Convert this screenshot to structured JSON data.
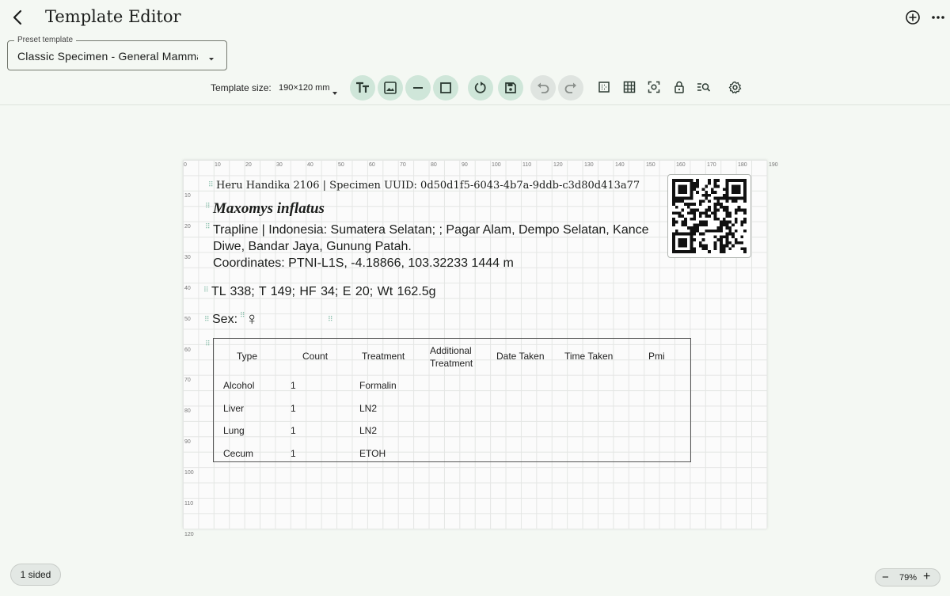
{
  "header": {
    "title": "Template Editor"
  },
  "preset": {
    "label": "Preset template",
    "value": "Classic Specimen - General Mammal"
  },
  "toolbar": {
    "size_label": "Template size:",
    "size_value": "190×120 mm",
    "buttons": [
      "text-icon",
      "image-icon",
      "line-icon",
      "rectangle-icon",
      "rotate-icon",
      "save-icon",
      "undo-icon",
      "redo-icon",
      "margin-icon",
      "grid-icon",
      "focus-icon",
      "lock-icon",
      "zoom-search-icon",
      "settings-icon"
    ]
  },
  "ruler": {
    "x": [
      "0",
      "10",
      "20",
      "30",
      "40",
      "50",
      "60",
      "70",
      "80",
      "90",
      "100",
      "110",
      "120",
      "130",
      "140",
      "150",
      "160",
      "170",
      "180",
      "190"
    ],
    "y": [
      "0",
      "10",
      "20",
      "30",
      "40",
      "50",
      "60",
      "70",
      "80",
      "90",
      "100",
      "110",
      "120"
    ]
  },
  "label": {
    "header": "Heru Handika 2106 | Specimen UUID:  0d50d1f5-6043-4b7a-9ddb-c3d80d413a77",
    "species": "Maxomys inflatus",
    "locality_1": "Trapline | Indonesia: Sumatera Selatan; ; Pagar Alam, Dempo Selatan, Kance Diwe, Bandar Jaya, Gunung Patah.",
    "locality_2": "Coordinates: PTNI-L1S, -4.18866, 103.32233 1444 m",
    "measurements": "TL 338;  T 149;  HF 34;  E 20;  Wt 162.5g",
    "sex_label": "Sex:",
    "sex_symbol": "♀"
  },
  "table": {
    "headers": [
      "Type",
      "Count",
      "Treatment",
      "Additional Treatment",
      "Date Taken",
      "Time Taken",
      "Pmi"
    ],
    "rows": [
      [
        "Alcohol",
        "1",
        "Formalin"
      ],
      [
        "Liver",
        "1",
        "LN2"
      ],
      [
        "Lung",
        "1",
        "LN2"
      ],
      [
        "Cecum",
        "1",
        "ETOH"
      ]
    ]
  },
  "footer": {
    "sided": "1 sided",
    "zoom": "79%"
  },
  "colors": {
    "accent": "#cfe6d9",
    "background": "#f4f8f3"
  }
}
